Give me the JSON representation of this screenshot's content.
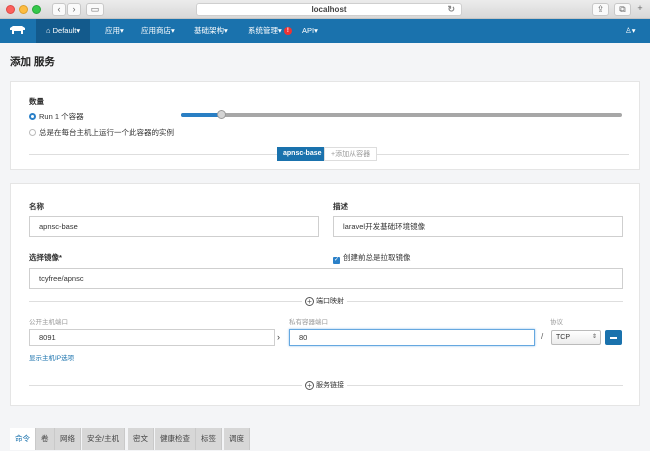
{
  "browser": {
    "url": "localhost"
  },
  "nav": {
    "environment": "Default",
    "items": [
      {
        "label": "应用"
      },
      {
        "label": "应用商店"
      },
      {
        "label": "基础架构"
      },
      {
        "label": "系统管理",
        "badge": "!"
      },
      {
        "label": "API"
      }
    ]
  },
  "page": {
    "title": "添加 服务"
  },
  "scale": {
    "label": "数量",
    "option_run": "Run 1 个容器",
    "option_every_host": "总是在每台主机上运行一个此容器的实例",
    "slider_level_fraction": 0.09
  },
  "container_tabs": {
    "current": "apnsc-base",
    "add_sidekick": "添加从容器"
  },
  "form": {
    "name_label": "名称",
    "name_value": "apnsc-base",
    "description_label": "描述",
    "description_value": "laravel开发基础环境镜像",
    "image_label": "选择镜像*",
    "pull_label": "创建前总是拉取镜像",
    "image_value": "tcyfree/apnsc"
  },
  "ports": {
    "section_label": "端口映射",
    "public_label": "公开主机端口",
    "private_label": "私有容器端口",
    "protocol_label": "协议",
    "public_value": "8091",
    "private_value": "80",
    "separator": "/",
    "protocol_value": "TCP",
    "show_ip_link": "显示主机IP选项"
  },
  "links": {
    "section_label": "服务链接"
  },
  "bottom_tabs": [
    "命令",
    "卷",
    "网络",
    "安全/主机",
    "密文",
    "健康检查",
    "标签",
    "调度"
  ],
  "colors": {
    "primary": "#1a72ad",
    "nav_active": "#135a8c"
  }
}
